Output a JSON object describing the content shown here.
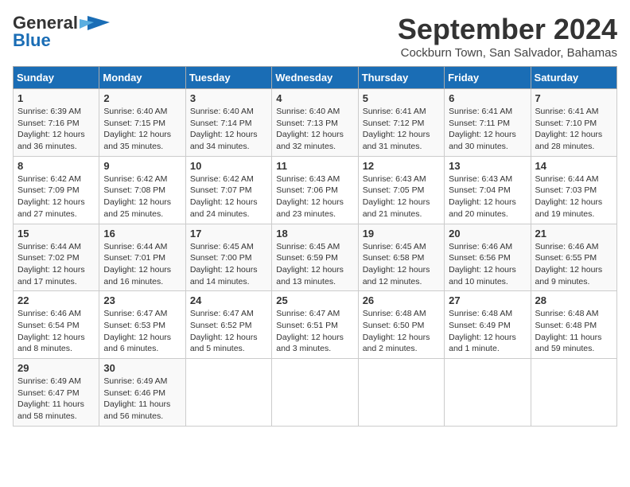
{
  "header": {
    "logo_general": "General",
    "logo_blue": "Blue",
    "month_title": "September 2024",
    "location": "Cockburn Town, San Salvador, Bahamas"
  },
  "calendar": {
    "days_of_week": [
      "Sunday",
      "Monday",
      "Tuesday",
      "Wednesday",
      "Thursday",
      "Friday",
      "Saturday"
    ],
    "weeks": [
      [
        {
          "day": "1",
          "sunrise": "6:39 AM",
          "sunset": "7:16 PM",
          "daylight": "12 hours and 36 minutes."
        },
        {
          "day": "2",
          "sunrise": "6:40 AM",
          "sunset": "7:15 PM",
          "daylight": "12 hours and 35 minutes."
        },
        {
          "day": "3",
          "sunrise": "6:40 AM",
          "sunset": "7:14 PM",
          "daylight": "12 hours and 34 minutes."
        },
        {
          "day": "4",
          "sunrise": "6:40 AM",
          "sunset": "7:13 PM",
          "daylight": "12 hours and 32 minutes."
        },
        {
          "day": "5",
          "sunrise": "6:41 AM",
          "sunset": "7:12 PM",
          "daylight": "12 hours and 31 minutes."
        },
        {
          "day": "6",
          "sunrise": "6:41 AM",
          "sunset": "7:11 PM",
          "daylight": "12 hours and 30 minutes."
        },
        {
          "day": "7",
          "sunrise": "6:41 AM",
          "sunset": "7:10 PM",
          "daylight": "12 hours and 28 minutes."
        }
      ],
      [
        {
          "day": "8",
          "sunrise": "6:42 AM",
          "sunset": "7:09 PM",
          "daylight": "12 hours and 27 minutes."
        },
        {
          "day": "9",
          "sunrise": "6:42 AM",
          "sunset": "7:08 PM",
          "daylight": "12 hours and 25 minutes."
        },
        {
          "day": "10",
          "sunrise": "6:42 AM",
          "sunset": "7:07 PM",
          "daylight": "12 hours and 24 minutes."
        },
        {
          "day": "11",
          "sunrise": "6:43 AM",
          "sunset": "7:06 PM",
          "daylight": "12 hours and 23 minutes."
        },
        {
          "day": "12",
          "sunrise": "6:43 AM",
          "sunset": "7:05 PM",
          "daylight": "12 hours and 21 minutes."
        },
        {
          "day": "13",
          "sunrise": "6:43 AM",
          "sunset": "7:04 PM",
          "daylight": "12 hours and 20 minutes."
        },
        {
          "day": "14",
          "sunrise": "6:44 AM",
          "sunset": "7:03 PM",
          "daylight": "12 hours and 19 minutes."
        }
      ],
      [
        {
          "day": "15",
          "sunrise": "6:44 AM",
          "sunset": "7:02 PM",
          "daylight": "12 hours and 17 minutes."
        },
        {
          "day": "16",
          "sunrise": "6:44 AM",
          "sunset": "7:01 PM",
          "daylight": "12 hours and 16 minutes."
        },
        {
          "day": "17",
          "sunrise": "6:45 AM",
          "sunset": "7:00 PM",
          "daylight": "12 hours and 14 minutes."
        },
        {
          "day": "18",
          "sunrise": "6:45 AM",
          "sunset": "6:59 PM",
          "daylight": "12 hours and 13 minutes."
        },
        {
          "day": "19",
          "sunrise": "6:45 AM",
          "sunset": "6:58 PM",
          "daylight": "12 hours and 12 minutes."
        },
        {
          "day": "20",
          "sunrise": "6:46 AM",
          "sunset": "6:56 PM",
          "daylight": "12 hours and 10 minutes."
        },
        {
          "day": "21",
          "sunrise": "6:46 AM",
          "sunset": "6:55 PM",
          "daylight": "12 hours and 9 minutes."
        }
      ],
      [
        {
          "day": "22",
          "sunrise": "6:46 AM",
          "sunset": "6:54 PM",
          "daylight": "12 hours and 8 minutes."
        },
        {
          "day": "23",
          "sunrise": "6:47 AM",
          "sunset": "6:53 PM",
          "daylight": "12 hours and 6 minutes."
        },
        {
          "day": "24",
          "sunrise": "6:47 AM",
          "sunset": "6:52 PM",
          "daylight": "12 hours and 5 minutes."
        },
        {
          "day": "25",
          "sunrise": "6:47 AM",
          "sunset": "6:51 PM",
          "daylight": "12 hours and 3 minutes."
        },
        {
          "day": "26",
          "sunrise": "6:48 AM",
          "sunset": "6:50 PM",
          "daylight": "12 hours and 2 minutes."
        },
        {
          "day": "27",
          "sunrise": "6:48 AM",
          "sunset": "6:49 PM",
          "daylight": "12 hours and 1 minute."
        },
        {
          "day": "28",
          "sunrise": "6:48 AM",
          "sunset": "6:48 PM",
          "daylight": "11 hours and 59 minutes."
        }
      ],
      [
        {
          "day": "29",
          "sunrise": "6:49 AM",
          "sunset": "6:47 PM",
          "daylight": "11 hours and 58 minutes."
        },
        {
          "day": "30",
          "sunrise": "6:49 AM",
          "sunset": "6:46 PM",
          "daylight": "11 hours and 56 minutes."
        },
        null,
        null,
        null,
        null,
        null
      ]
    ],
    "labels": {
      "sunrise": "Sunrise:",
      "sunset": "Sunset:",
      "daylight": "Daylight:"
    }
  }
}
